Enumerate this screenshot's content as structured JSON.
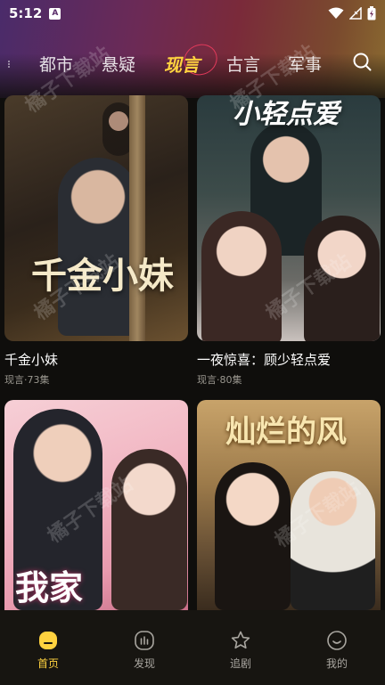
{
  "status": {
    "time": "5:12",
    "app_icon": "A"
  },
  "nav": {
    "tabs": [
      {
        "label": "都市",
        "active": false
      },
      {
        "label": "悬疑",
        "active": false
      },
      {
        "label": "现言",
        "active": true
      },
      {
        "label": "古言",
        "active": false
      },
      {
        "label": "军事",
        "active": false
      }
    ]
  },
  "cards": [
    {
      "poster_title": "千金小妹",
      "title": "千金小妹",
      "meta": "现言·73集"
    },
    {
      "poster_title": "小轻点爱",
      "title": "一夜惊喜：顾少轻点爱",
      "meta": "现言·80集"
    },
    {
      "poster_title": "我家",
      "title": "",
      "meta": ""
    },
    {
      "poster_title": "灿烂的风",
      "title": "",
      "meta": ""
    }
  ],
  "watermark": "橘子下载站",
  "tabbar": [
    {
      "label": "首页",
      "icon": "home-icon",
      "active": true
    },
    {
      "label": "发现",
      "icon": "discover-icon",
      "active": false
    },
    {
      "label": "追剧",
      "icon": "star-icon",
      "active": false
    },
    {
      "label": "我的",
      "icon": "profile-icon",
      "active": false
    }
  ],
  "colors": {
    "accent": "#ffd23f",
    "ring": "#e33a5b"
  }
}
